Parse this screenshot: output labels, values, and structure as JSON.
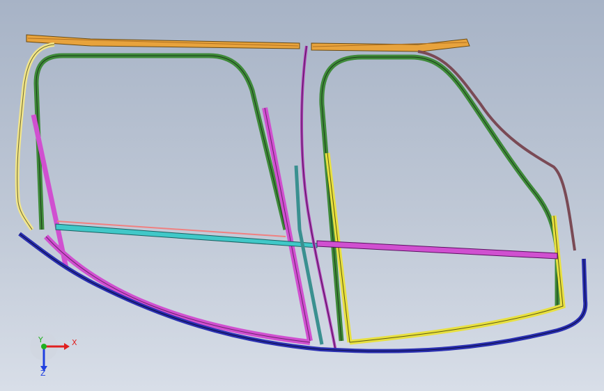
{
  "viewport": {
    "background_top": "#a7b3c6",
    "background_bottom": "#d8dee8"
  },
  "parts": {
    "roof_rail_color": "#e8a33c",
    "front_door_frame_color": "#3f8a3a",
    "rear_door_frame_color": "#3f8a3a",
    "a_pillar_color": "#f1e58a",
    "b_pillar_color": "#c040c8",
    "belt_line_front_color": "#40c8c8",
    "belt_line_rear_color": "#d050d0",
    "sill_color": "#2a2fb0",
    "rear_pillar_color": "#e8e040",
    "c_pillar_color": "#7a4a55"
  },
  "triad": {
    "x_label": "X",
    "y_label": "Y",
    "z_label": "Z",
    "x_color": "#e02020",
    "y_color": "#20b020",
    "z_color": "#2040e0"
  }
}
